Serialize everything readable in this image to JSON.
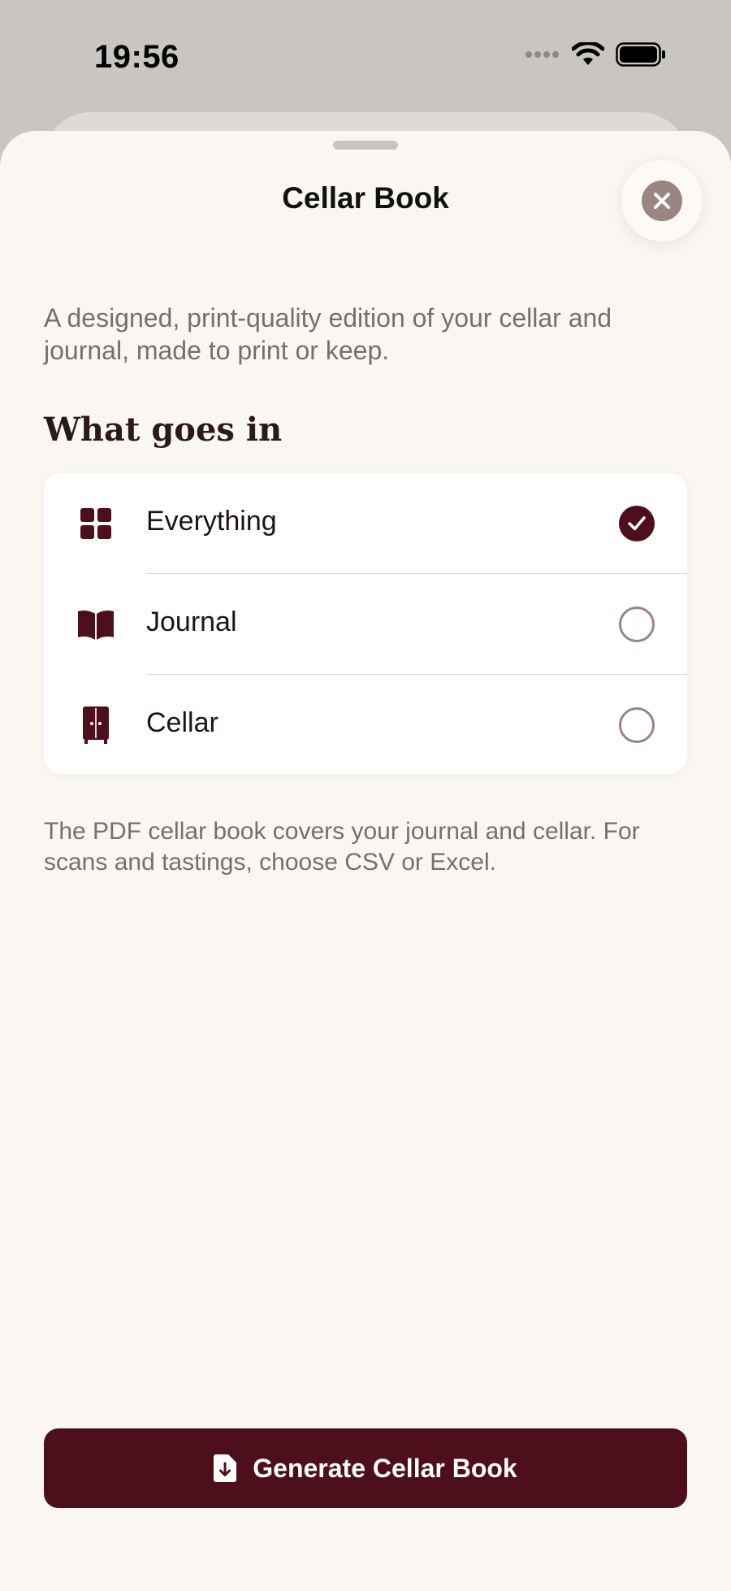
{
  "status_bar": {
    "time": "19:56"
  },
  "sheet": {
    "title": "Cellar Book",
    "description": "A designed, print-quality edition of your cellar and journal, made to print or keep.",
    "section_heading": "What goes in",
    "options": [
      {
        "label": "Everything",
        "icon": "grid-icon",
        "selected": true
      },
      {
        "label": "Journal",
        "icon": "book-icon",
        "selected": false
      },
      {
        "label": "Cellar",
        "icon": "cabinet-icon",
        "selected": false
      }
    ],
    "footnote": "The PDF cellar book covers your journal and cellar. For scans and tastings, choose CSV or Excel.",
    "generate_label": "Generate Cellar Book"
  },
  "colors": {
    "accent": "#4e0f1c",
    "sheet_background": "#faf7f2",
    "muted_text": "#7a6e6a",
    "radio_border": "#9a8580"
  }
}
